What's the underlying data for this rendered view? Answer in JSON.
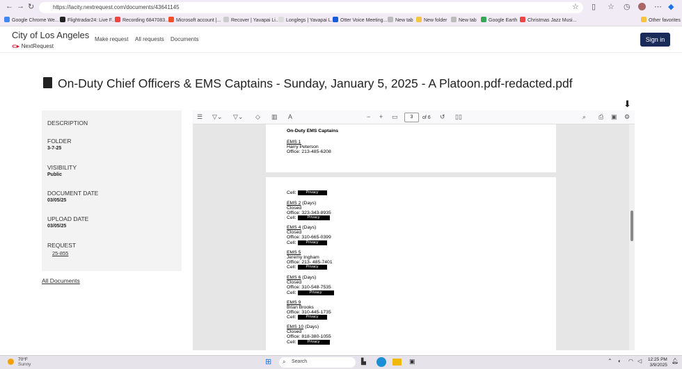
{
  "browser": {
    "url": "https://lacity.nextrequest.com/documents/43641145",
    "bookmarks": [
      "Google Chrome We...",
      "Flightradar24: Live F...",
      "Recording 6847083...",
      "Microsoft account |...",
      "Recover | Yavapai Li...",
      "Longlegs | Yavapai L...",
      "Otter Voice Meeting...",
      "New tab",
      "New folder",
      "New tab",
      "Google Earth",
      "Christmas Jazz Musi...",
      "Other favorites"
    ]
  },
  "site": {
    "city": "City of Los Angeles",
    "brand": "NextRequest",
    "nav": [
      "Make request",
      "All requests",
      "Documents"
    ],
    "signin": "Sign in"
  },
  "document": {
    "title": "On-Duty Chief Officers & EMS Captains - Sunday, January 5, 2025 - A Platoon.pdf-redacted.pdf"
  },
  "sidebar": {
    "description_label": "DESCRIPTION",
    "folder_label": "FOLDER",
    "folder_value": "3-7-25",
    "visibility_label": "VISIBILITY",
    "visibility_value": "Public",
    "docdate_label": "DOCUMENT DATE",
    "docdate_value": "03/05/25",
    "uploaddate_label": "UPLOAD DATE",
    "uploaddate_value": "03/05/25",
    "request_label": "REQUEST",
    "request_value": "25-855",
    "all_documents": "All Documents"
  },
  "pdf": {
    "page": "3",
    "of": "of 6",
    "page1": {
      "heading": "On-Duty EMS Captains",
      "ems1": "EMS 1",
      "ems1_name": "Harry Peterson",
      "ems1_office": "Office: 213-485-6208"
    },
    "page2": {
      "cell": "Cell:",
      "privacy": "Privacy",
      "closed": "Closed",
      "days": "(Days)",
      "ems2": "EMS 2",
      "ems2_office": "Office: 323-343-8935",
      "ems4": "EMS 4",
      "ems4_office": "Office: 310-665-0399",
      "ems5": "EMS 5",
      "ems5_name": "Jeremy Ingham",
      "ems5_office": "Office: 213- 485-7401",
      "ems6": "EMS 6",
      "ems6_office": "Office: 310-548-7535",
      "ems9": "EMS 9",
      "ems9_name": "Brian Brooks",
      "ems9_office": "Office: 310-445-1735",
      "ems10": "EMS 10",
      "ems10_office": "Office: 818-380-1055"
    }
  },
  "taskbar": {
    "temp": "70°F",
    "condition": "Sunny",
    "search": "Search",
    "time": "12:25 PM",
    "date": "3/9/2025"
  }
}
